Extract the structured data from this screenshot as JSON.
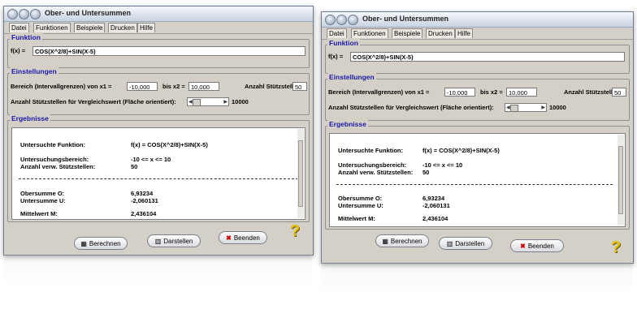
{
  "window": {
    "title": "Ober- und Untersummen",
    "menu": [
      "Datei",
      "Funktionen",
      "Beispiele",
      "Drucken",
      "Hilfe"
    ]
  },
  "funktion": {
    "group_label": "Funktion",
    "label": "f(x) =",
    "value": "COS(X^2/8)+SIN(X-5)"
  },
  "einstellungen": {
    "group_label": "Einstellungen",
    "bereich_label": "Bereich (Intervallgrenzen) von x1 =",
    "x1": "-10,000",
    "bis_label": "bis x2 =",
    "x2": "10,000",
    "stuetz_label": "Anzahl Stützstellen:",
    "stuetz_value": "50",
    "vergleich_label": "Anzahl Stützstellen für Vergleichswert (Fläche orientiert):",
    "vergleich_value": "10000"
  },
  "ergebnisse": {
    "group_label": "Ergebnisse",
    "funktion_label": "Untersuchte Funktion:",
    "funktion_value": "f(x) = COS(X^2/8)+SIN(X-5)",
    "bereich_label": "Untersuchungsbereich:",
    "bereich_value": "-10 <= x <= 10",
    "anzahl_label": "Anzahl verw. Stützstellen:",
    "anzahl_value": "50",
    "obersumme_label": "Obersumme O:",
    "obersumme_value": "6,93234",
    "untersumme_label": "Untersumme U:",
    "untersumme_value": "-2,060131",
    "mittelwert_label": "Mittelwert M:",
    "mittelwert_value": "2,436104",
    "mittelwert_value_right": "2,436104"
  },
  "buttons": {
    "berechnen": "Berechnen",
    "darstellen": "Darstellen",
    "beenden": "Beenden"
  },
  "colors": {
    "window_bg": "#d4d0c8",
    "group_label": "#1a1aa8",
    "help_icon": "#e6c000"
  }
}
